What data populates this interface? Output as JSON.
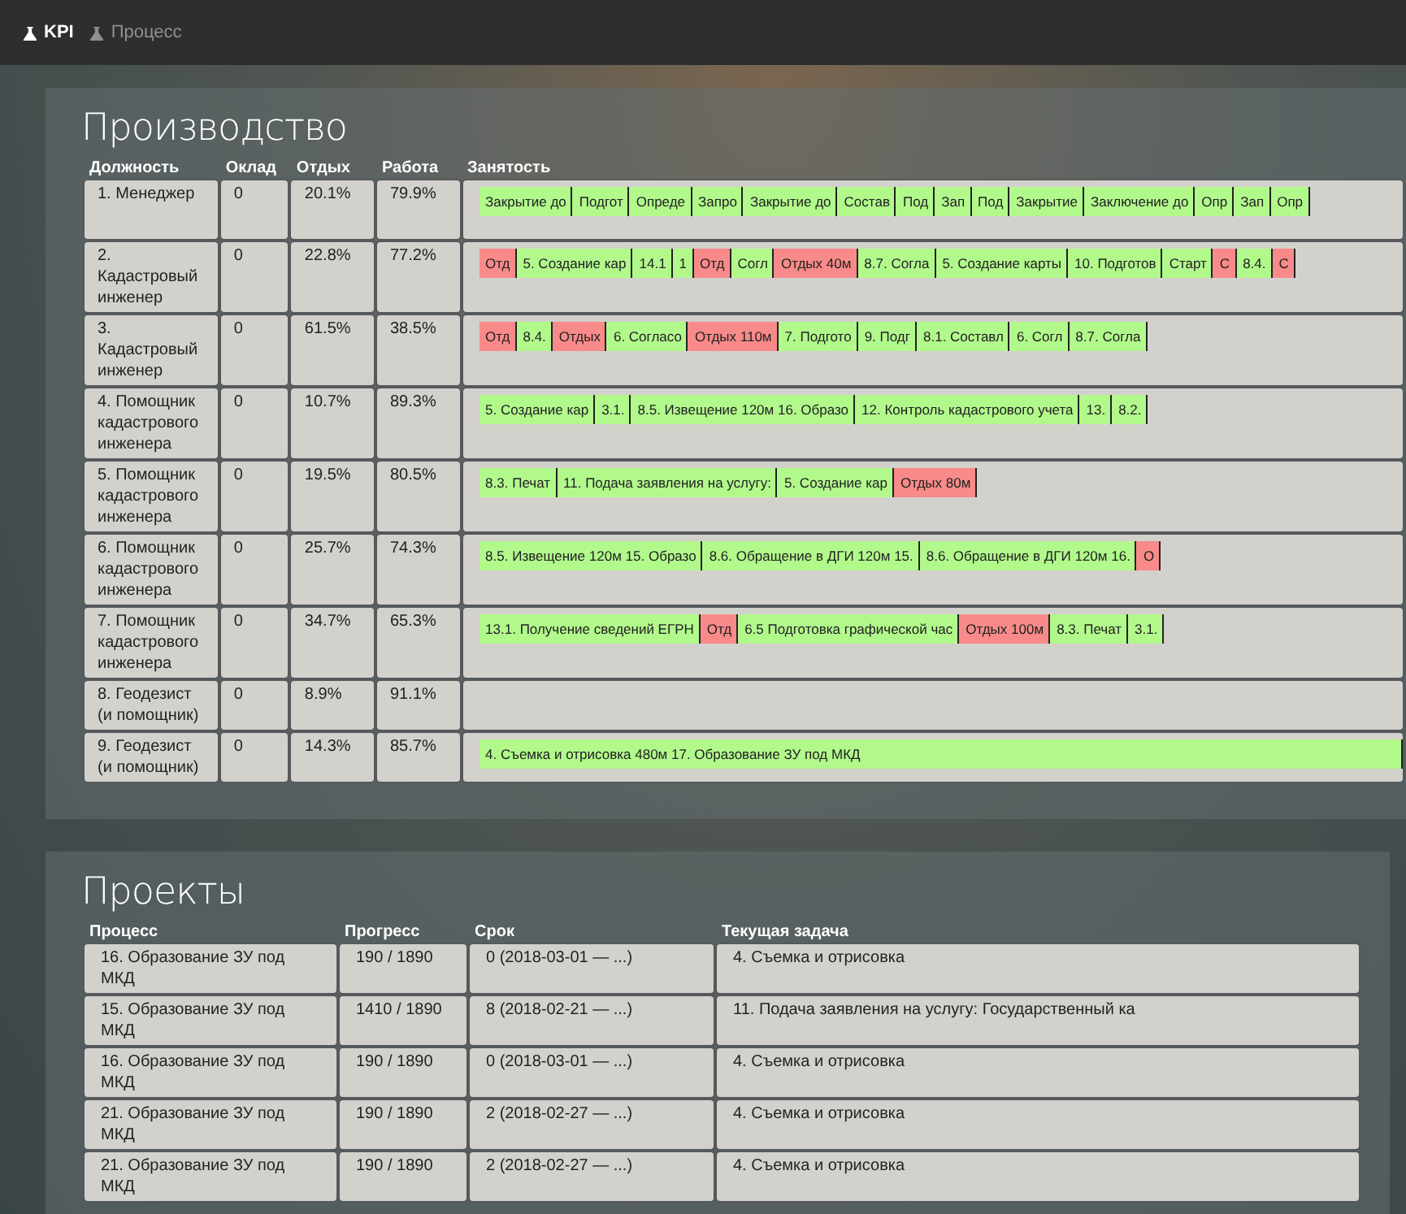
{
  "nav": [
    {
      "label": "KPI",
      "selected": true
    },
    {
      "label": "Процесс",
      "selected": false
    }
  ],
  "production": {
    "title": "Производство",
    "columns": [
      "Должность",
      "Оклад",
      "Отдых",
      "Работа",
      "Занятость"
    ],
    "rows": [
      {
        "position": "1. Менеджер",
        "salary": "0",
        "rest": "20.1%",
        "work": "79.9%",
        "segments": [
          {
            "kind": "work",
            "text": "Закрытие до"
          },
          {
            "kind": "work",
            "text": "Подгот"
          },
          {
            "kind": "work",
            "text": "Опреде"
          },
          {
            "kind": "work",
            "text": "Запро"
          },
          {
            "kind": "work",
            "text": "Закрытие до"
          },
          {
            "kind": "work",
            "text": "Состав"
          },
          {
            "kind": "work",
            "text": "Под"
          },
          {
            "kind": "work",
            "text": "Зап"
          },
          {
            "kind": "work",
            "text": "Под"
          },
          {
            "kind": "work",
            "text": "Закрытие"
          },
          {
            "kind": "work",
            "text": "Заключение до"
          },
          {
            "kind": "work",
            "text": "Опр"
          },
          {
            "kind": "work",
            "text": "Зап"
          },
          {
            "kind": "work",
            "text": "Опр"
          }
        ]
      },
      {
        "position": "2. Кадастровый инженер",
        "salary": "0",
        "rest": "22.8%",
        "work": "77.2%",
        "segments": [
          {
            "kind": "rest",
            "text": "Отд"
          },
          {
            "kind": "work",
            "text": "5. Создание кар"
          },
          {
            "kind": "work",
            "text": "14.1"
          },
          {
            "kind": "work",
            "text": "1"
          },
          {
            "kind": "rest",
            "text": "Отд"
          },
          {
            "kind": "work",
            "text": "Согл"
          },
          {
            "kind": "rest",
            "text": "Отдых 40м"
          },
          {
            "kind": "work",
            "text": "8.7. Согла"
          },
          {
            "kind": "work",
            "text": "5. Создание карты"
          },
          {
            "kind": "work",
            "text": "10. Подготов"
          },
          {
            "kind": "work",
            "text": "Старт"
          },
          {
            "kind": "rest",
            "text": "С"
          },
          {
            "kind": "work",
            "text": "8.4."
          },
          {
            "kind": "rest",
            "text": "С"
          }
        ]
      },
      {
        "position": "3. Кадастровый инженер",
        "salary": "0",
        "rest": "61.5%",
        "work": "38.5%",
        "segments": [
          {
            "kind": "rest",
            "text": "Отд"
          },
          {
            "kind": "work",
            "text": "8.4."
          },
          {
            "kind": "rest",
            "text": "Отдых"
          },
          {
            "kind": "work",
            "text": "6. Согласо"
          },
          {
            "kind": "rest",
            "text": "Отдых 110м"
          },
          {
            "kind": "work",
            "text": "7. Подгото"
          },
          {
            "kind": "work",
            "text": "9. Подг"
          },
          {
            "kind": "work",
            "text": "8.1. Составл"
          },
          {
            "kind": "work",
            "text": "6. Согл"
          },
          {
            "kind": "work",
            "text": "8.7. Согла"
          }
        ]
      },
      {
        "position": "4. Помощник кадастрового инженера",
        "salary": "0",
        "rest": "10.7%",
        "work": "89.3%",
        "segments": [
          {
            "kind": "work",
            "text": "5. Создание кар"
          },
          {
            "kind": "work",
            "text": "3.1."
          },
          {
            "kind": "work",
            "text": "8.5. Извещение 120м 16. Образо"
          },
          {
            "kind": "work",
            "text": "12. Контроль кадастрового учета"
          },
          {
            "kind": "work",
            "text": "13."
          },
          {
            "kind": "work",
            "text": "8.2."
          }
        ]
      },
      {
        "position": "5. Помощник кадастрового инженера",
        "salary": "0",
        "rest": "19.5%",
        "work": "80.5%",
        "segments": [
          {
            "kind": "work",
            "text": "8.3. Печат"
          },
          {
            "kind": "work",
            "text": "11. Подача заявления на услугу:"
          },
          {
            "kind": "work",
            "text": "5. Создание кар"
          },
          {
            "kind": "rest",
            "text": "Отдых 80м"
          }
        ]
      },
      {
        "position": "6. Помощник кадастрового инженера",
        "salary": "0",
        "rest": "25.7%",
        "work": "74.3%",
        "segments": [
          {
            "kind": "work",
            "text": "8.5. Извещение 120м 15. Образо"
          },
          {
            "kind": "work",
            "text": "8.6. Обращение в ДГИ 120м 15."
          },
          {
            "kind": "work",
            "text": "8.6. Обращение в ДГИ 120м 16."
          },
          {
            "kind": "rest",
            "text": "О"
          }
        ]
      },
      {
        "position": "7. Помощник кадастрового инженера",
        "salary": "0",
        "rest": "34.7%",
        "work": "65.3%",
        "segments": [
          {
            "kind": "work",
            "text": "13.1. Получение сведений ЕГРН"
          },
          {
            "kind": "rest",
            "text": "Отд"
          },
          {
            "kind": "work",
            "text": "6.5 Подготовка графической час"
          },
          {
            "kind": "rest",
            "text": "Отдых 100м"
          },
          {
            "kind": "work",
            "text": "8.3. Печат"
          },
          {
            "kind": "work",
            "text": "3.1."
          }
        ]
      },
      {
        "position": "8. Геодезист (и помощник)",
        "salary": "0",
        "rest": "8.9%",
        "work": "91.1%",
        "segments": []
      },
      {
        "position": "9. Геодезист (и помощник)",
        "salary": "0",
        "rest": "14.3%",
        "work": "85.7%",
        "segments": [
          {
            "kind": "work",
            "text": "4. Съемка и отрисовка 480м 17. Образование ЗУ под МКД"
          }
        ]
      }
    ]
  },
  "projects": {
    "title": "Проекты",
    "columns": [
      "Процесс",
      "Прогресс",
      "Срок",
      "Текущая задача"
    ],
    "rows": [
      [
        "16. Образование ЗУ под МКД",
        "190 / 1890",
        "0 (2018-03-01 — ...)",
        "4. Съемка и отрисовка"
      ],
      [
        "15. Образование ЗУ под МКД",
        "1410 / 1890",
        "8 (2018-02-21 — ...)",
        "11. Подача заявления на услугу: Государственный ка"
      ],
      [
        "16. Образование ЗУ под МКД",
        "190 / 1890",
        "0 (2018-03-01 — ...)",
        "4. Съемка и отрисовка"
      ],
      [
        "21. Образование ЗУ под МКД",
        "190 / 1890",
        "2 (2018-02-27 — ...)",
        "4. Съемка и отрисовка"
      ],
      [
        "21. Образование ЗУ под МКД",
        "190 / 1890",
        "2 (2018-02-27 — ...)",
        "4. Съемка и отрисовка"
      ]
    ]
  }
}
